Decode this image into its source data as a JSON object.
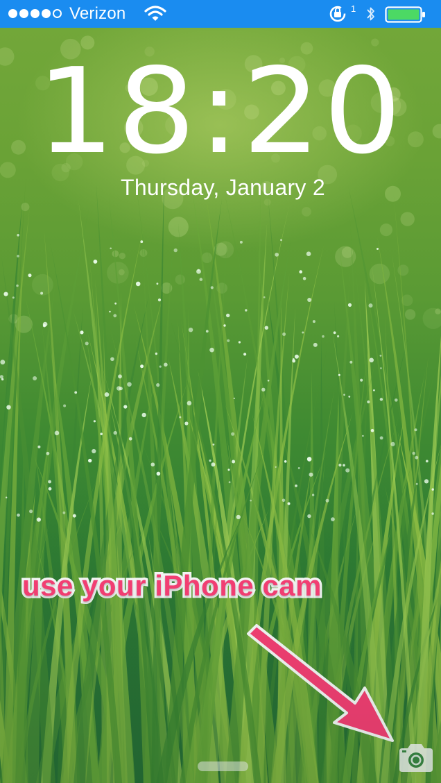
{
  "status_bar": {
    "carrier": "Verizon",
    "signal_strength": 4,
    "signal_max": 5,
    "rotation_lock_count": "1",
    "battery_level": 1.0,
    "background_color": "#1a8cf0",
    "icons": [
      "wifi-icon",
      "rotation-lock-icon",
      "bluetooth-icon",
      "battery-icon"
    ]
  },
  "lock_screen": {
    "time": "18:20",
    "date": "Thursday, January 2",
    "wallpaper": "green grass with dew drops"
  },
  "annotation": {
    "text": "use your iPhone cam",
    "color": "#ff3f77"
  },
  "bottom": {
    "camera_icon": "camera-icon",
    "home_indicator": "grabber"
  }
}
